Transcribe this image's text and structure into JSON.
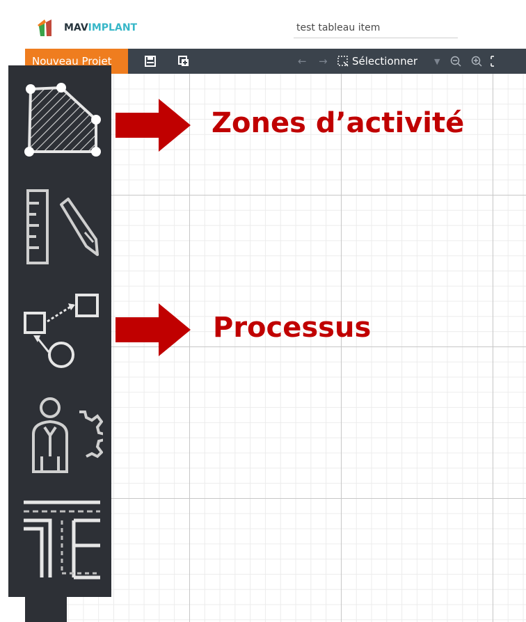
{
  "header": {
    "logo_brand_part1": "MAV",
    "logo_brand_part2": "IMPLANT",
    "project_name": "test tableau item"
  },
  "toolbar": {
    "new_project_label": "Nouveau Projet",
    "save_icon": "save-icon",
    "duplicate_icon": "duplicate-icon",
    "undo_icon": "arrow-left-icon",
    "redo_icon": "arrow-right-icon",
    "select_label": "Sélectionner",
    "zoom_out_icon": "zoom-out-icon",
    "zoom_in_icon": "zoom-in-icon"
  },
  "side_tools": [
    {
      "name": "activity-zone-polygon-icon"
    },
    {
      "name": "ruler-pencil-icon"
    },
    {
      "name": "process-flow-icon"
    },
    {
      "name": "person-gear-icon"
    },
    {
      "name": "corridor-layout-icon"
    }
  ],
  "annotations": {
    "zones_label": "Zones d’activité",
    "process_label": "Processus"
  },
  "colors": {
    "accent_orange": "#ef7d1f",
    "toolbar_dark": "#3b434c",
    "panel_dark": "#2d3036",
    "annotation_red": "#c00000",
    "logo_teal": "#38b7c8"
  }
}
